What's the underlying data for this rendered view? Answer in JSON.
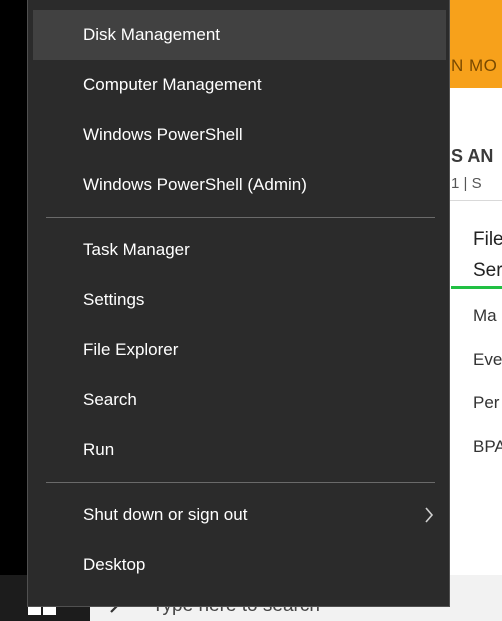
{
  "background_window": {
    "banner_text": "N MO",
    "heading": "S AN",
    "subheading": "1 | S",
    "tile_title_line1": "File",
    "tile_title_line2": "Ser",
    "items": [
      "Ma",
      "Eve",
      "Per",
      "BPA"
    ],
    "accent_color": "#f7a11b"
  },
  "context_menu": {
    "items": [
      {
        "label": "Disk Management",
        "highlighted": true
      },
      {
        "label": "Computer Management"
      },
      {
        "label": "Windows PowerShell"
      },
      {
        "label": "Windows PowerShell (Admin)"
      },
      {
        "label": "Task Manager"
      },
      {
        "label": "Settings"
      },
      {
        "label": "File Explorer"
      },
      {
        "label": "Search"
      },
      {
        "label": "Run"
      },
      {
        "label": "Shut down or sign out",
        "submenu": true
      },
      {
        "label": "Desktop"
      }
    ]
  },
  "taskbar": {
    "start_icon": "windows-logo-icon",
    "search_icon": "search-icon",
    "search_placeholder": "Type here to search"
  }
}
